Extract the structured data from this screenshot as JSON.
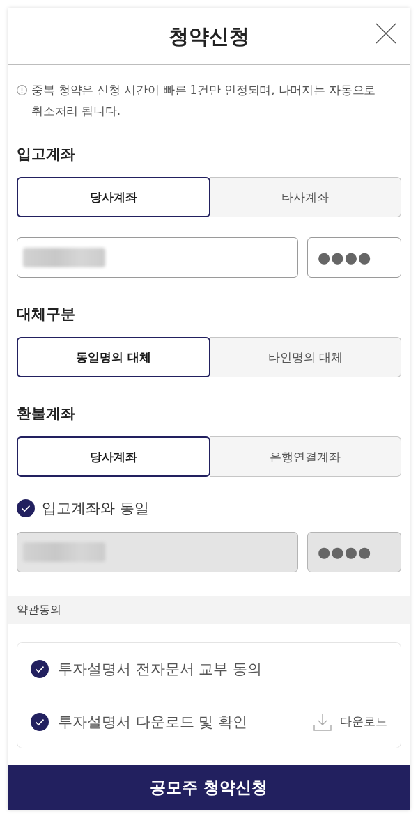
{
  "header": {
    "title": "청약신청"
  },
  "notice": {
    "text": "중복 청약은 신청 시간이 빠른 1건만 인정되며, 나머지는 자동으로 취소처리 됩니다."
  },
  "sections": [
    {
      "label": "입고계좌",
      "options": [
        {
          "label": "당사계좌",
          "selected": true
        },
        {
          "label": "타사계좌",
          "selected": false
        }
      ],
      "fields": {
        "pin": "●●●●",
        "disabled": false
      }
    },
    {
      "label": "대체구분",
      "options": [
        {
          "label": "동일명의 대체",
          "selected": true
        },
        {
          "label": "타인명의 대체",
          "selected": false
        }
      ]
    },
    {
      "label": "환불계좌",
      "options": [
        {
          "label": "당사계좌",
          "selected": true
        },
        {
          "label": "은행연결계좌",
          "selected": false
        }
      ],
      "checkbox": {
        "label": "입고계좌와 동일",
        "checked": true
      },
      "fields": {
        "pin": "●●●●",
        "disabled": true
      }
    }
  ],
  "terms": {
    "title": "약관동의",
    "items": [
      {
        "label": "투자설명서 전자문서 교부 동의",
        "checked": true
      },
      {
        "label": "투자설명서 다운로드 및 확인",
        "checked": true,
        "download": "다운로드"
      }
    ]
  },
  "submit": {
    "label": "공모주 청약신청"
  }
}
